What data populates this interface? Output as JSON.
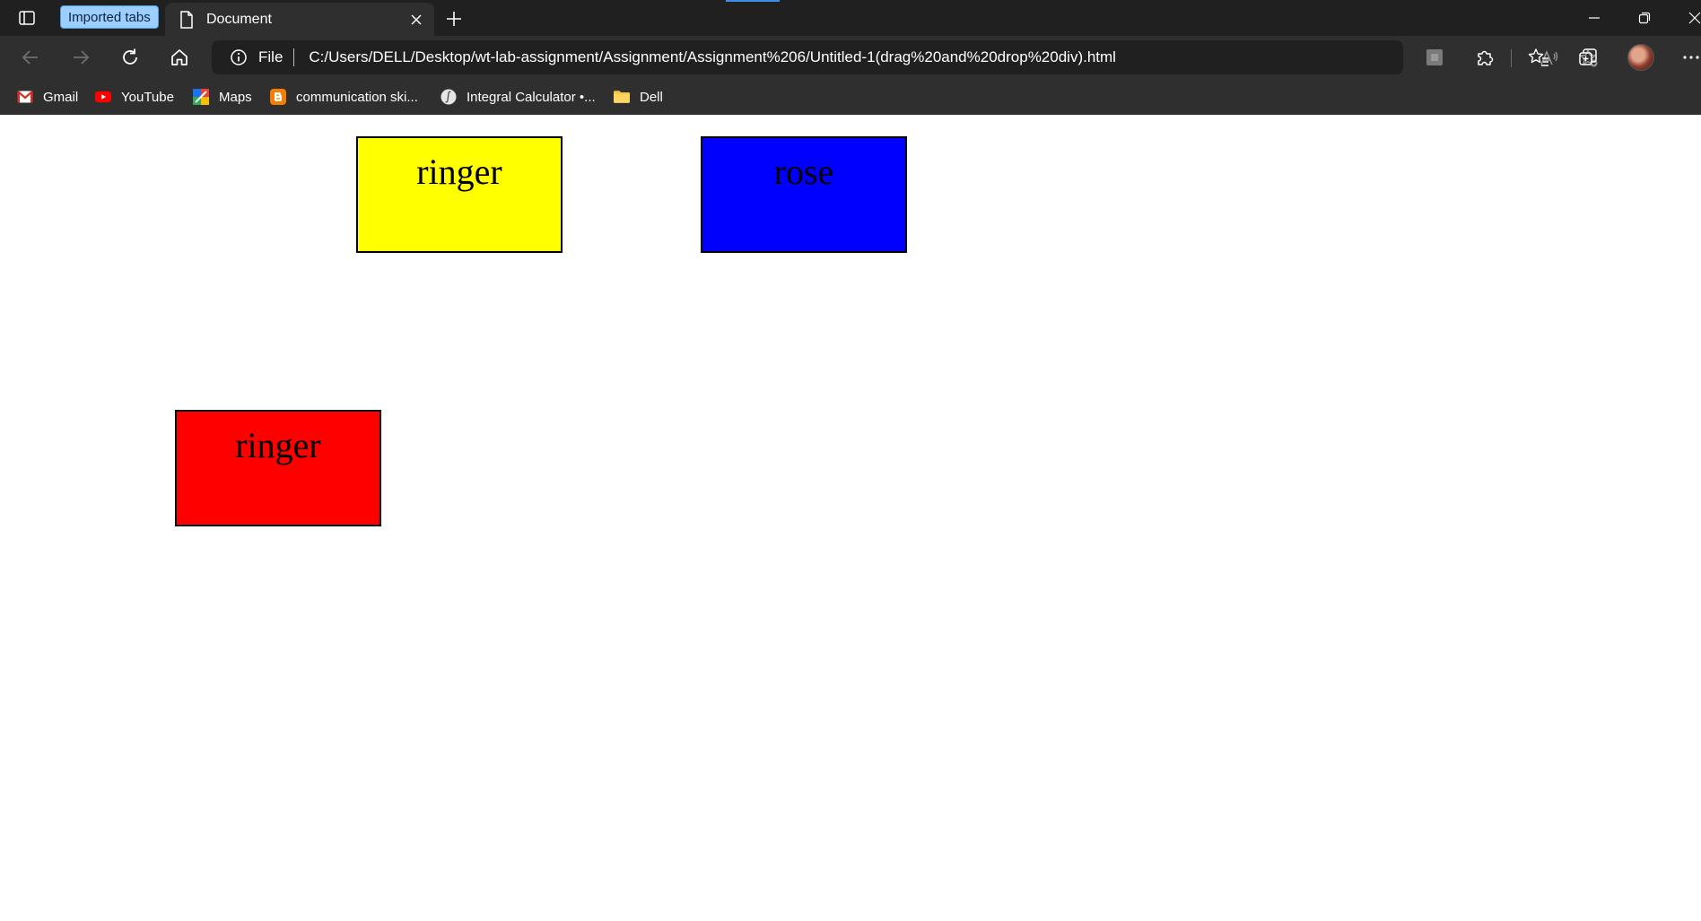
{
  "browser": {
    "imported_tabs_label": "Imported tabs",
    "tab": {
      "title": "Document"
    },
    "address": {
      "scheme": "File",
      "url": "C:/Users/DELL/Desktop/wt-lab-assignment/Assignment/Assignment%206/Untitled-1(drag%20and%20drop%20div).html"
    },
    "bookmarks": [
      {
        "label": "Gmail",
        "icon": "gmail-icon"
      },
      {
        "label": "YouTube",
        "icon": "youtube-icon"
      },
      {
        "label": "Maps",
        "icon": "maps-icon"
      },
      {
        "label": "communication ski...",
        "icon": "blogger-icon"
      },
      {
        "label": "Integral Calculator •...",
        "icon": "integral-calculator-icon"
      },
      {
        "label": "Dell",
        "icon": "folder-icon"
      }
    ]
  },
  "page": {
    "boxes": [
      {
        "label": "ringer",
        "color": "#ffff00"
      },
      {
        "label": "rose",
        "color": "#0000ff"
      },
      {
        "label": "ringer",
        "color": "#ff0000"
      }
    ]
  }
}
